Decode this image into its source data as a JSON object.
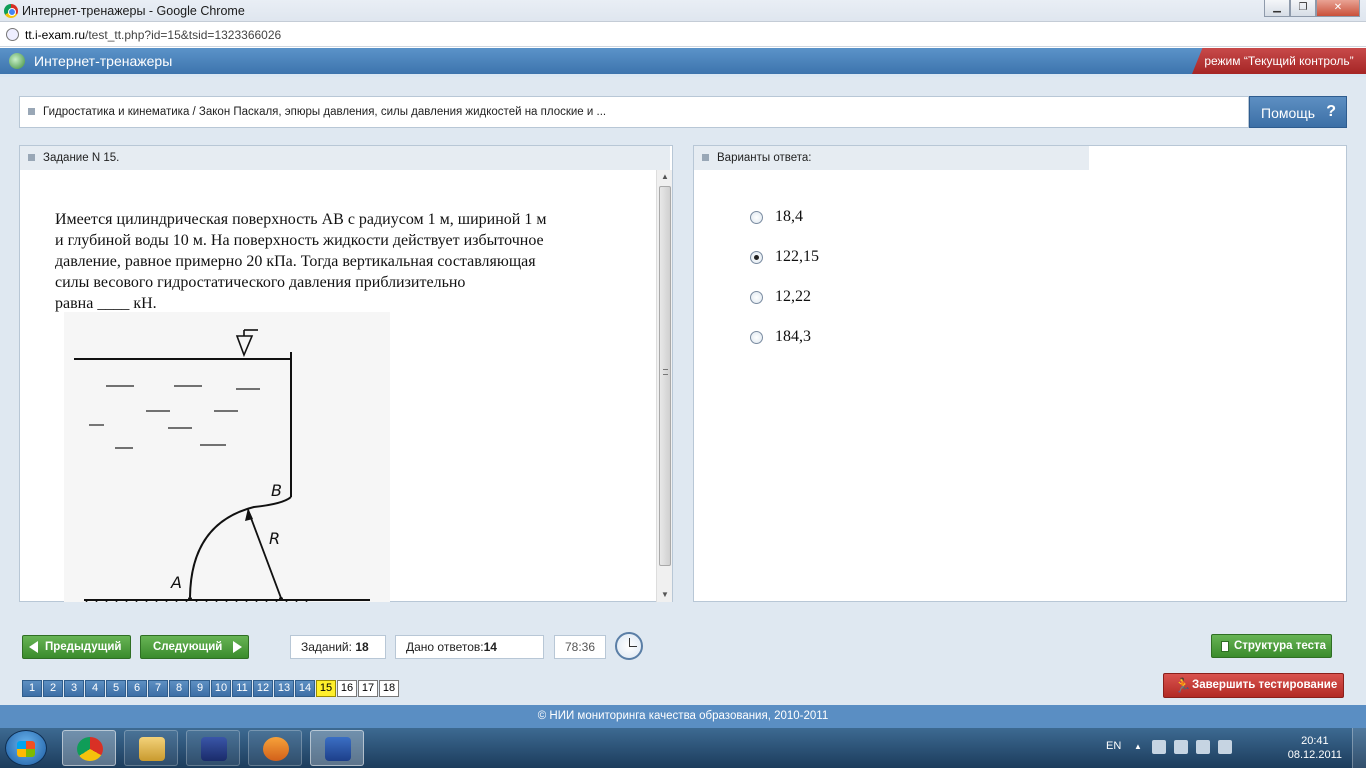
{
  "window": {
    "title": "Интернет-тренажеры - Google Chrome"
  },
  "browser": {
    "url_host": "tt.i-exam.ru",
    "url_path": "/test_tt.php?id=15&tsid=1323366026"
  },
  "site": {
    "name": "Интернет-тренажеры",
    "mode": "режим “Текущий контроль”"
  },
  "breadcrumb": "Гидростатика и кинематика / Закон Паскаля, эпюры давления, силы давления жидкостей на плоские и ...",
  "help_label": "Помощь",
  "help_icon": "?",
  "task": {
    "header": "Задание N 15.",
    "question_lines": [
      "Имеется цилиндрическая поверхность АВ с радиусом 1 м, шириной 1 м",
      "и глубиной воды 10 м. На поверхность жидкости действует избыточное",
      "давление, равное примерно 20 кПа. Тогда вертикальная составляющая",
      "силы весового гидростатического давления приблизительно",
      "равна ____ кН."
    ],
    "figure_labels": {
      "a": "A",
      "b": "B",
      "r": "R"
    }
  },
  "answers": {
    "header": "Варианты ответа:",
    "options": [
      {
        "label": "18,4",
        "selected": false
      },
      {
        "label": "122,15",
        "selected": true
      },
      {
        "label": "12,22",
        "selected": false
      },
      {
        "label": "184,3",
        "selected": false
      }
    ]
  },
  "controls": {
    "prev_label": "Предыдущий",
    "next_label": "Следующий",
    "tasks_label": "Заданий:",
    "tasks_count": "18",
    "answered_label": "Дано ответов:",
    "answered_count": "14",
    "timer": "78:36",
    "structure_label": "Структура теста",
    "finish_label": "Завершить тестирование"
  },
  "pages": {
    "items": [
      "1",
      "2",
      "3",
      "4",
      "5",
      "6",
      "7",
      "8",
      "9",
      "10",
      "11",
      "12",
      "13",
      "14",
      "15",
      "16",
      "17",
      "18"
    ],
    "current": "15",
    "unanswered": [
      "16",
      "17",
      "18"
    ]
  },
  "footer": "© НИИ мониторинга качества образования, 2010-2011",
  "taskbar": {
    "lang": "EN",
    "time": "20:41",
    "date": "08.12.2011"
  },
  "colors": {
    "header_blue": "#3d74ad",
    "mode_red": "#a52525",
    "nav_green": "#3a8b2c",
    "current_page": "#ffef2b"
  }
}
